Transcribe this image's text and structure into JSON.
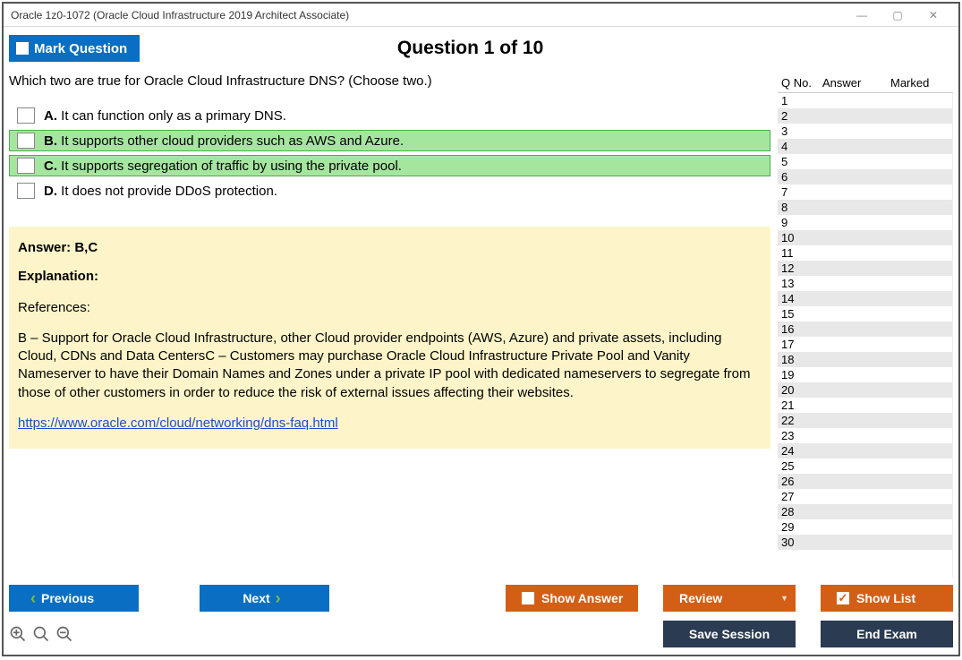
{
  "window": {
    "title": "Oracle 1z0-1072 (Oracle Cloud Infrastructure 2019 Architect Associate)"
  },
  "header": {
    "mark_label": "Mark Question",
    "question_title": "Question 1 of 10"
  },
  "question": {
    "text": "Which two are true for Oracle Cloud Infrastructure DNS? (Choose two.)",
    "options": [
      {
        "letter": "A.",
        "text": "It can function only as a primary DNS.",
        "correct": false
      },
      {
        "letter": "B.",
        "text": "It supports other cloud providers such as AWS and Azure.",
        "correct": true
      },
      {
        "letter": "C.",
        "text": "It supports segregation of traffic by using the private pool.",
        "correct": true
      },
      {
        "letter": "D.",
        "text": "It does not provide DDoS protection.",
        "correct": false
      }
    ]
  },
  "explanation": {
    "answer_label": "Answer: B,C",
    "explanation_label": "Explanation:",
    "references_label": "References:",
    "body": "B – Support for Oracle Cloud Infrastructure, other Cloud provider endpoints (AWS, Azure) and private assets, including Cloud, CDNs and Data CentersC – Customers may purchase Oracle Cloud Infrastructure Private Pool and Vanity Nameserver to have their Domain Names and Zones under a private IP pool with dedicated nameservers to segregate from those of other customers in order to reduce the risk of external issues affecting their websites.",
    "link": "https://www.oracle.com/cloud/networking/dns-faq.html"
  },
  "qlist": {
    "headers": {
      "qno": "Q No.",
      "answer": "Answer",
      "marked": "Marked"
    },
    "rows": 30
  },
  "buttons": {
    "previous": "Previous",
    "next": "Next",
    "show_answer": "Show Answer",
    "review": "Review",
    "show_list": "Show List",
    "save_session": "Save Session",
    "end_exam": "End Exam"
  }
}
